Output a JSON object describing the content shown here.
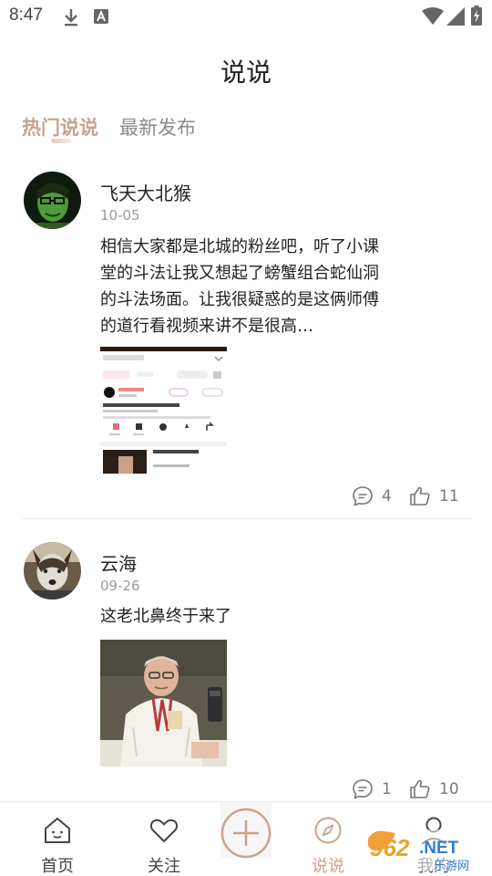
{
  "status_bar": {
    "time": "8:47",
    "left_icons": [
      "download-icon",
      "keyboard-a-icon"
    ],
    "right_icons": [
      "wifi-icon",
      "signal-icon",
      "battery-icon"
    ]
  },
  "header": {
    "title": "说说"
  },
  "tabs": [
    {
      "label": "热门说说",
      "active": true
    },
    {
      "label": "最新发布",
      "active": false
    }
  ],
  "posts": [
    {
      "username": "飞天大北猴",
      "date": "10-05",
      "text": "相信大家都是北城的粉丝吧，听了小课堂的斗法让我又想起了螃蟹组合蛇仙洞的斗法场面。让我很疑惑的是这俩师傅的道行看视频来讲不是很高…",
      "image": "app-screenshot-thumbnail",
      "comments": "4",
      "likes": "11"
    },
    {
      "username": "云海",
      "date": "09-26",
      "text": "这老北鼻终于来了",
      "image": "man-in-white-shirt-photo",
      "comments": "1",
      "likes": "10"
    }
  ],
  "bottom_nav": [
    {
      "label": "首页",
      "icon": "home-icon",
      "active": false
    },
    {
      "label": "关注",
      "icon": "heart-icon",
      "active": false
    },
    {
      "label": "",
      "icon": "plus-icon",
      "active": false
    },
    {
      "label": "说说",
      "icon": "compass-icon",
      "active": true
    },
    {
      "label": "我的",
      "icon": "user-icon",
      "active": false
    }
  ],
  "watermark": {
    "text": "962.NET",
    "subtext": "乐游网"
  },
  "colors": {
    "accent": "#c9a390",
    "text": "#222222",
    "muted": "#9a9a9a",
    "divider": "#eeeeee"
  }
}
